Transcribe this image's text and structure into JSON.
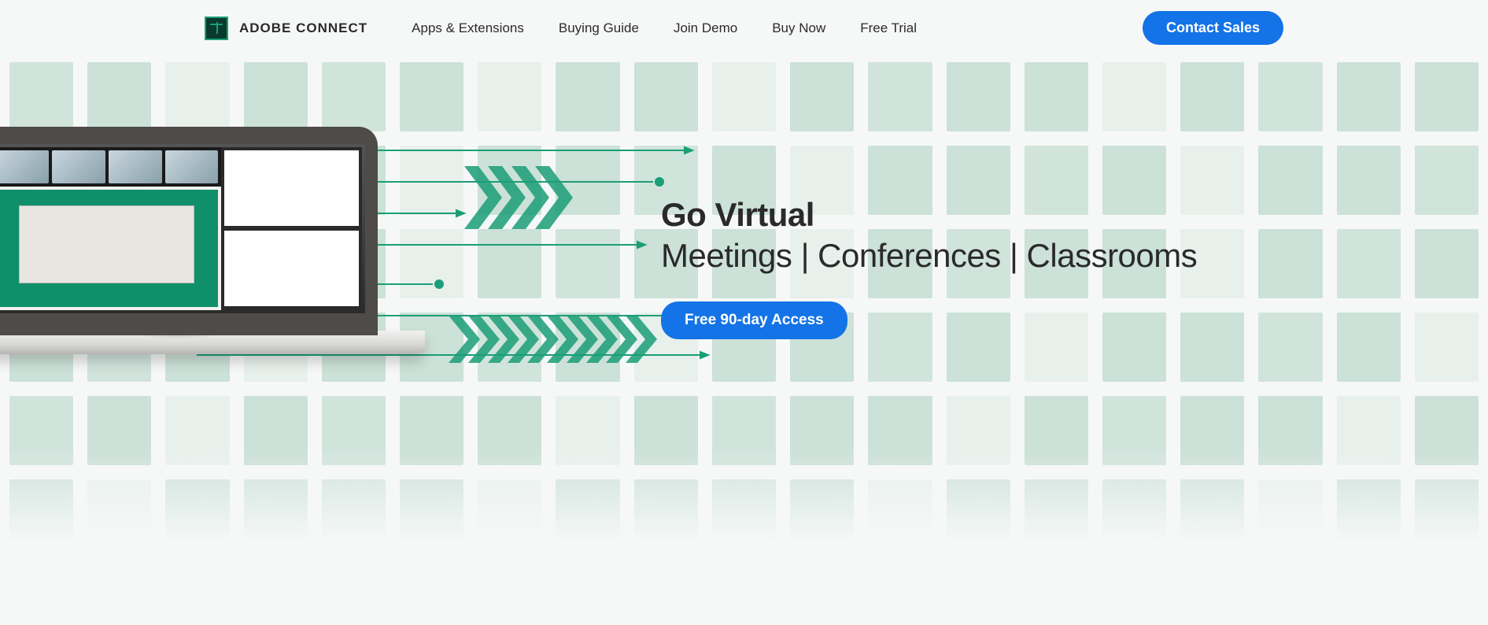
{
  "nav": {
    "brand": "ADOBE CONNECT",
    "links": [
      "Apps & Extensions",
      "Buying Guide",
      "Join Demo",
      "Buy Now",
      "Free Trial"
    ],
    "contact_label": "Contact Sales"
  },
  "hero": {
    "title": "Go Virtual",
    "subtitle": "Meetings | Conferences | Classrooms",
    "cta_label": "Free 90-day Access"
  }
}
